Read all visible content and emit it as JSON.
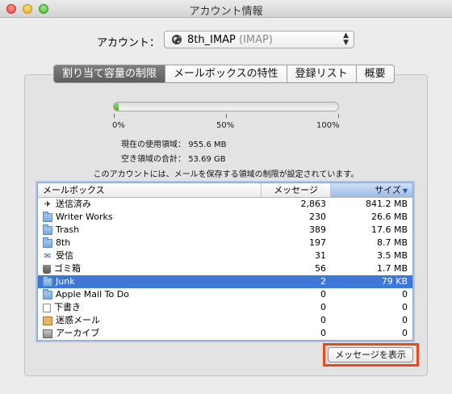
{
  "window": {
    "title": "アカウント情報"
  },
  "account": {
    "label": "アカウント：",
    "name": "8th_IMAP",
    "type": "(IMAP)"
  },
  "tabs": [
    {
      "label": "割り当て容量の制限",
      "active": true
    },
    {
      "label": "メールボックスの特性",
      "active": false
    },
    {
      "label": "登録リスト",
      "active": false
    },
    {
      "label": "概要",
      "active": false
    }
  ],
  "quota": {
    "usage_fraction": 0.02,
    "ticks": [
      "0%",
      "50%",
      "100%"
    ],
    "used_label": "現在の使用領域：",
    "used_value": "955.6 MB",
    "free_label": "空き領域の合計：",
    "free_value": "53.69 GB",
    "notice": "このアカウントには、メールを保存する領域の制限が設定されています。"
  },
  "table": {
    "columns": {
      "name": "メールボックス",
      "messages": "メッセージ",
      "size": "サイズ"
    },
    "rows": [
      {
        "name": "送信済み",
        "messages": "2,863",
        "size": "841.2 MB",
        "icon": "sent-icon"
      },
      {
        "name": "Writer Works",
        "messages": "230",
        "size": "26.6 MB",
        "icon": "folder-icon"
      },
      {
        "name": "Trash",
        "messages": "389",
        "size": "17.6 MB",
        "icon": "folder-icon"
      },
      {
        "name": "8th",
        "messages": "197",
        "size": "8.7 MB",
        "icon": "folder-icon"
      },
      {
        "name": "受信",
        "messages": "31",
        "size": "3.5 MB",
        "icon": "inbox-icon"
      },
      {
        "name": "ゴミ箱",
        "messages": "56",
        "size": "1.7 MB",
        "icon": "trash-icon"
      },
      {
        "name": "Junk",
        "messages": "2",
        "size": "79 KB",
        "icon": "folder-icon",
        "selected": true
      },
      {
        "name": "Apple Mail To Do",
        "messages": "0",
        "size": "0",
        "icon": "folder-icon"
      },
      {
        "name": "下書き",
        "messages": "0",
        "size": "0",
        "icon": "draft-icon"
      },
      {
        "name": "迷惑メール",
        "messages": "0",
        "size": "0",
        "icon": "junk-mail-icon"
      },
      {
        "name": "アーカイブ",
        "messages": "0",
        "size": "0",
        "icon": "archive-icon"
      }
    ]
  },
  "buttons": {
    "show_messages": "メッセージを表示"
  },
  "colors": {
    "accent": "#3d78d8",
    "highlight": "#e8491d",
    "gauge": "#5fb83a"
  }
}
